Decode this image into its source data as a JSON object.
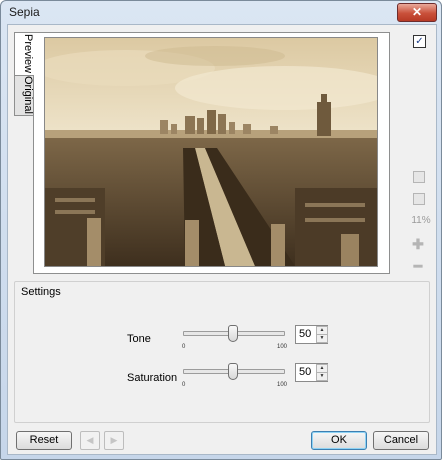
{
  "window": {
    "title": "Sepia",
    "close_label": "✕"
  },
  "tabs": [
    {
      "label": "Preview",
      "active": true
    },
    {
      "label": "Original",
      "active": false
    }
  ],
  "preview": {
    "show_checkbox_checked": true,
    "zoom_level": "11%"
  },
  "settings": {
    "title": "Settings",
    "sliders": [
      {
        "label": "Tone",
        "value": "50",
        "min_label": "0",
        "max_label": "100",
        "level": 0.5
      },
      {
        "label": "Saturation",
        "value": "50",
        "min_label": "0",
        "max_label": "100",
        "level": 0.5
      }
    ]
  },
  "buttons": {
    "reset": "Reset",
    "ok": "OK",
    "cancel": "Cancel",
    "back": "◀",
    "forward": "▶"
  },
  "icons": {
    "check": "✓",
    "plus": "✚",
    "minus": "━",
    "up": "▲",
    "down": "▼"
  },
  "colors": {
    "sepia_light": "#d9c8a4",
    "sepia_dark": "#5a4630",
    "sky": "#ece2c8"
  }
}
